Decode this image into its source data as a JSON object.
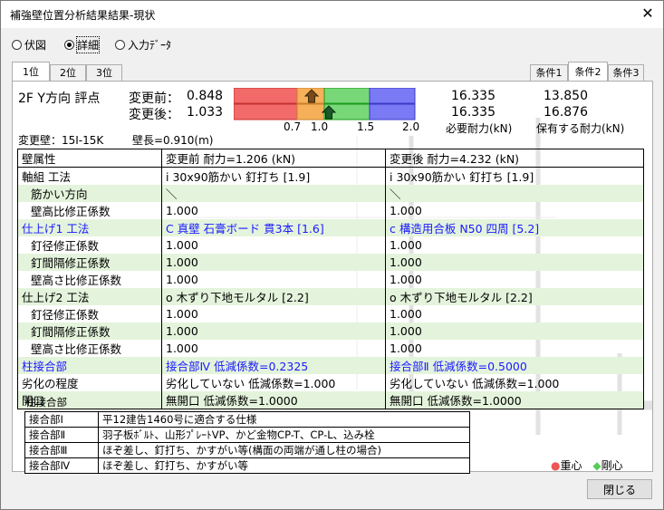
{
  "window": {
    "title": "補強壁位置分析結果結果-現状",
    "close_glyph": "✕"
  },
  "view_modes": [
    {
      "label": "伏図",
      "selected": false
    },
    {
      "label": "詳細",
      "selected": true
    },
    {
      "label": "入力ﾃﾞｰﾀ",
      "selected": false
    }
  ],
  "rank_tabs": [
    "1位",
    "2位",
    "3位"
  ],
  "condition_tabs": [
    "条件1",
    "条件2",
    "条件3"
  ],
  "summary": {
    "direction": "2F Y方向 評点",
    "before_label": "変更前：",
    "before_value": "0.848",
    "after_label": "変更後：",
    "after_value": "1.033",
    "scale_ticks": [
      "0.7",
      "1.0",
      "1.5",
      "2.0"
    ],
    "required_before": "16.335",
    "required_after": "16.335",
    "held_before": "13.850",
    "held_after": "16.876",
    "required_label": "必要耐力(kN)",
    "held_label": "保有する耐力(kN)",
    "changed_wall": "変更壁：15I-15K",
    "wall_length": "壁長=0.910(m)"
  },
  "table": {
    "header": [
      "壁属性",
      "変更前 耐力=1.206 (kN)",
      "変更後 耐力=4.232 (kN)"
    ],
    "rows": [
      {
        "label": "軸組 工法",
        "before": "i 30x90筋かい 釘打ち [1.9]",
        "after": "i 30x90筋かい 釘打ち [1.9]",
        "blue": false,
        "sub": false
      },
      {
        "label": "筋かい方向",
        "before": "＼",
        "after": "＼",
        "blue": false,
        "sub": true
      },
      {
        "label": "壁高比修正係数",
        "before": "1.000",
        "after": "1.000",
        "blue": false,
        "sub": true
      },
      {
        "label": "仕上げ1 工法",
        "before": "C 真壁 石膏ボード 貫3本 [1.6]",
        "after": "c 構造用合板 N50 四周 [5.2]",
        "blue": true,
        "sub": false
      },
      {
        "label": "釘径修正係数",
        "before": "1.000",
        "after": "1.000",
        "blue": false,
        "sub": true
      },
      {
        "label": "釘間隔修正係数",
        "before": "1.000",
        "after": "1.000",
        "blue": false,
        "sub": true
      },
      {
        "label": "壁高さ比修正係数",
        "before": "1.000",
        "after": "1.000",
        "blue": false,
        "sub": true
      },
      {
        "label": "仕上げ2 工法",
        "before": "o 木ずり下地モルタル [2.2]",
        "after": "o 木ずり下地モルタル [2.2]",
        "blue": false,
        "sub": false
      },
      {
        "label": "釘径修正係数",
        "before": "1.000",
        "after": "1.000",
        "blue": false,
        "sub": true
      },
      {
        "label": "釘間隔修正係数",
        "before": "1.000",
        "after": "1.000",
        "blue": false,
        "sub": true
      },
      {
        "label": "壁高さ比修正係数",
        "before": "1.000",
        "after": "1.000",
        "blue": false,
        "sub": true
      },
      {
        "label": "柱接合部",
        "before": "接合部Ⅳ 低減係数=0.2325",
        "after": "接合部Ⅱ 低減係数=0.5000",
        "blue": true,
        "sub": false
      },
      {
        "label": "劣化の程度",
        "before": "劣化していない 低減係数=1.000",
        "after": "劣化していない 低減係数=1.000",
        "blue": false,
        "sub": false
      },
      {
        "label": "開口",
        "before": "無開口 低減係数=1.0000",
        "after": "無開口 低減係数=1.0000",
        "blue": false,
        "sub": false
      }
    ]
  },
  "joint_legend": {
    "title": "柱接合部",
    "rows": [
      {
        "code": "接合部Ⅰ",
        "desc": "平12建告1460号に適合する仕様"
      },
      {
        "code": "接合部Ⅱ",
        "desc": "羽子板ﾎﾞﾙﾄ、山形ﾌﾟﾚｰﾄVP、かど金物CP-T、CP-L、込み栓"
      },
      {
        "code": "接合部Ⅲ",
        "desc": "ほぞ差し、釘打ち、かすがい等(構面の両端が通し柱の場合)"
      },
      {
        "code": "接合部Ⅳ",
        "desc": "ほぞ差し、釘打ち、かすがい等"
      }
    ]
  },
  "markers": {
    "center_gravity": "重心",
    "center_rigidity": "剛心"
  },
  "colors": {
    "red": "#f26a6a",
    "orange": "#f7b05a",
    "green": "#78d878",
    "blue": "#7a7af5",
    "row_green": "#e4f4dc",
    "blue_text": "#1a1aff"
  },
  "close_button": "閉じる"
}
